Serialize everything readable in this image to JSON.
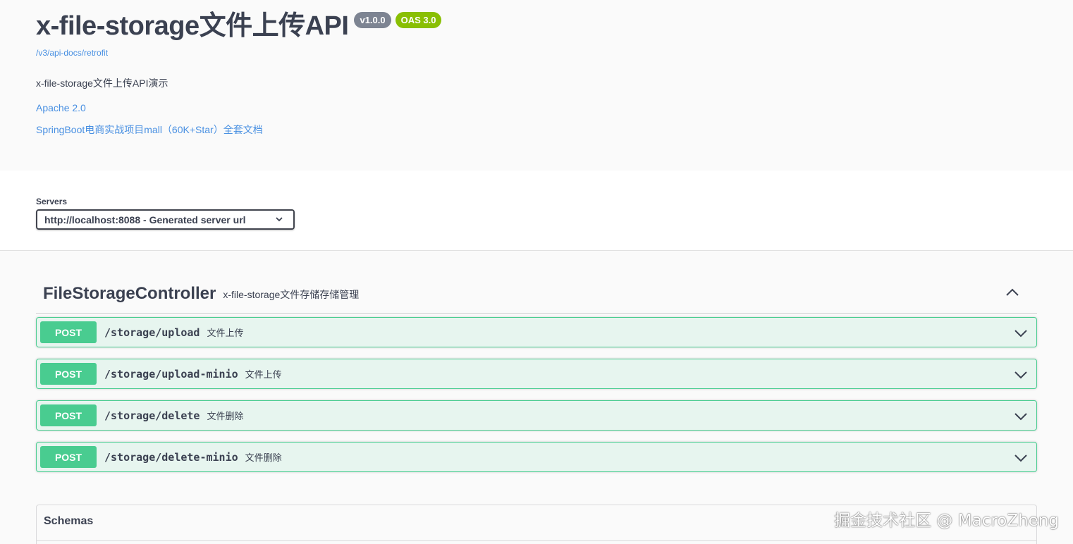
{
  "info": {
    "title": "x-file-storage文件上传API",
    "version_badge": "v1.0.0",
    "oas_badge": "OAS 3.0",
    "spec_url": "/v3/api-docs/retrofit",
    "description": "x-file-storage文件上传API演示",
    "license": "Apache 2.0",
    "external_docs": "SpringBoot电商实战项目mall（60K+Star）全套文档"
  },
  "servers": {
    "label": "Servers",
    "selected": "http://localhost:8088 - Generated server url"
  },
  "controller": {
    "name": "FileStorageController",
    "description": "x-file-storage文件存储存储管理",
    "operations": [
      {
        "method": "POST",
        "path": "/storage/upload",
        "summary": "文件上传"
      },
      {
        "method": "POST",
        "path": "/storage/upload-minio",
        "summary": "文件上传"
      },
      {
        "method": "POST",
        "path": "/storage/delete",
        "summary": "文件删除"
      },
      {
        "method": "POST",
        "path": "/storage/delete-minio",
        "summary": "文件删除"
      }
    ]
  },
  "schemas": {
    "title": "Schemas"
  },
  "watermark": "掘金技术社区 @ MacroZheng",
  "colors": {
    "post_green": "#49cc90",
    "link_blue": "#4990e2",
    "badge_gray": "#7d8492",
    "badge_green": "#89bf04"
  },
  "icons": {
    "server_select": "chevron-down-icon",
    "controller_toggle": "chevron-up-icon",
    "operation_toggle": "chevron-down-icon"
  }
}
